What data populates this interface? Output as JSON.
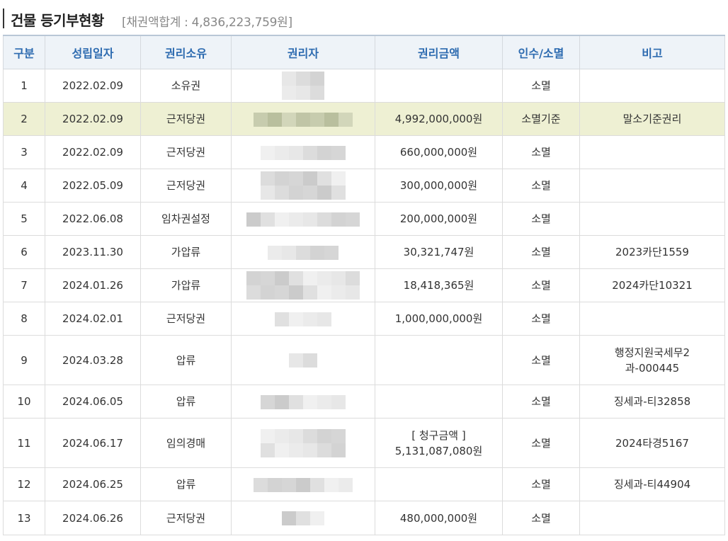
{
  "header": {
    "title": "건물 등기부현황",
    "sum_text": "[채권액합계 : 4,836,223,759원]"
  },
  "table": {
    "columns": [
      "구분",
      "성립일자",
      "권리소유",
      "권리자",
      "권리금액",
      "인수/소멸",
      "비고"
    ],
    "rows": [
      {
        "no": "1",
        "date": "2022.02.09",
        "type": "소유권",
        "amount": "",
        "amount2": "",
        "status": "소멸",
        "note": "",
        "note2": ""
      },
      {
        "no": "2",
        "date": "2022.02.09",
        "type": "근저당권",
        "amount": "4,992,000,000원",
        "amount2": "",
        "status": "소멸기준",
        "note": "말소기준권리",
        "note2": ""
      },
      {
        "no": "3",
        "date": "2022.02.09",
        "type": "근저당권",
        "amount": "660,000,000원",
        "amount2": "",
        "status": "소멸",
        "note": "",
        "note2": ""
      },
      {
        "no": "4",
        "date": "2022.05.09",
        "type": "근저당권",
        "amount": "300,000,000원",
        "amount2": "",
        "status": "소멸",
        "note": "",
        "note2": ""
      },
      {
        "no": "5",
        "date": "2022.06.08",
        "type": "임차권설정",
        "amount": "200,000,000원",
        "amount2": "",
        "status": "소멸",
        "note": "",
        "note2": ""
      },
      {
        "no": "6",
        "date": "2023.11.30",
        "type": "가압류",
        "amount": "30,321,747원",
        "amount2": "",
        "status": "소멸",
        "note": "2023카단1559",
        "note2": ""
      },
      {
        "no": "7",
        "date": "2024.01.26",
        "type": "가압류",
        "amount": "18,418,365원",
        "amount2": "",
        "status": "소멸",
        "note": "2024카단10321",
        "note2": ""
      },
      {
        "no": "8",
        "date": "2024.02.01",
        "type": "근저당권",
        "amount": "1,000,000,000원",
        "amount2": "",
        "status": "소멸",
        "note": "",
        "note2": ""
      },
      {
        "no": "9",
        "date": "2024.03.28",
        "type": "압류",
        "amount": "",
        "amount2": "",
        "status": "소멸",
        "note": "행정지원국세무2",
        "note2": "과-000445"
      },
      {
        "no": "10",
        "date": "2024.06.05",
        "type": "압류",
        "amount": "",
        "amount2": "",
        "status": "소멸",
        "note": "징세과-티32858",
        "note2": ""
      },
      {
        "no": "11",
        "date": "2024.06.17",
        "type": "임의경매",
        "amount": "[ 청구금액 ]",
        "amount2": "5,131,087,080원",
        "status": "소멸",
        "note": "2024타경5167",
        "note2": ""
      },
      {
        "no": "12",
        "date": "2024.06.25",
        "type": "압류",
        "amount": "",
        "amount2": "",
        "status": "소멸",
        "note": "징세과-티44904",
        "note2": ""
      },
      {
        "no": "13",
        "date": "2024.06.26",
        "type": "근저당권",
        "amount": "480,000,000원",
        "amount2": "",
        "status": "소멸",
        "note": "",
        "note2": ""
      }
    ]
  },
  "colors": {
    "header_text": "#2d6bb0",
    "header_bg": "#eef3f8",
    "highlight_row_bg": "#eef0d3",
    "alert_text": "#d01f1f"
  }
}
